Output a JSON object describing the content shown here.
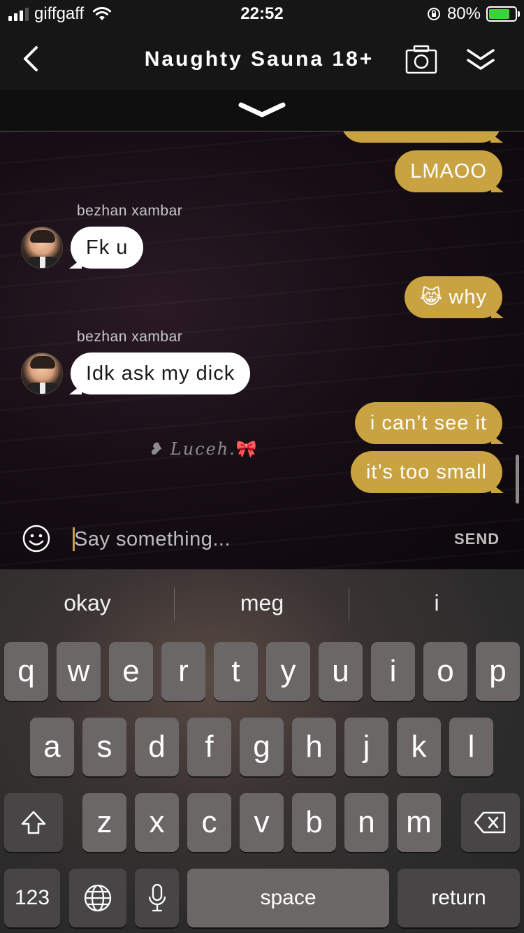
{
  "status_bar": {
    "carrier": "giffgaff",
    "time": "22:52",
    "battery": "80%",
    "battery_level": 0.8,
    "signal_bars": 3
  },
  "nav": {
    "title": "Naughty Sauna 18+",
    "back_icon": "chevron-left-icon",
    "camera_icon": "camera-icon",
    "collapse_icon": "double-chevron-down-icon"
  },
  "messages": [
    {
      "side": "out",
      "text": "LMAOO"
    },
    {
      "side": "in",
      "sender": "bezhan xambar",
      "text": "Fk u"
    },
    {
      "side": "out",
      "emoji": "😹",
      "text": "why"
    },
    {
      "side": "in",
      "sender": "bezhan xambar",
      "text": "Idk ask my dick"
    },
    {
      "side": "out",
      "text": "i can’t see it"
    },
    {
      "side": "out",
      "text": "it’s too small"
    }
  ],
  "watermark": {
    "text": "Luceh.",
    "prefix": "❥",
    "bow": "🎀"
  },
  "composer": {
    "placeholder": "Say something...",
    "send_label": "SEND"
  },
  "keyboard": {
    "suggestions": [
      "okay",
      "meg",
      "i"
    ],
    "row1": [
      "q",
      "w",
      "e",
      "r",
      "t",
      "y",
      "u",
      "i",
      "o",
      "p"
    ],
    "row2": [
      "a",
      "s",
      "d",
      "f",
      "g",
      "h",
      "j",
      "k",
      "l"
    ],
    "row3": [
      "z",
      "x",
      "c",
      "v",
      "b",
      "n",
      "m"
    ],
    "numbers_label": "123",
    "space_label": "space",
    "return_label": "return"
  },
  "colors": {
    "outgoing_bubble": "#c9a242",
    "incoming_bubble": "#ffffff",
    "accent": "#c9a242"
  }
}
